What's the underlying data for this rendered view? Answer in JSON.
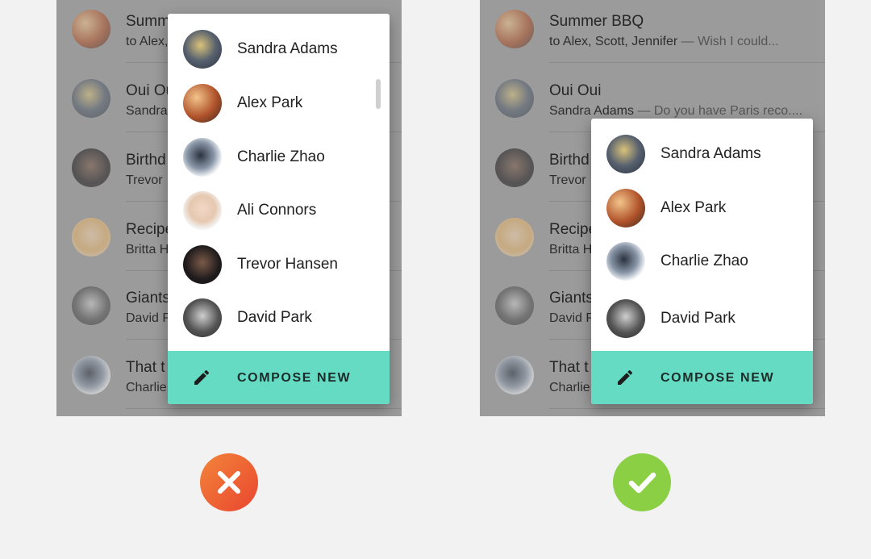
{
  "background_list": [
    {
      "title": "Summer BBQ",
      "sender": "to Alex, Scott, Jennifer",
      "snippet": "— Wish I could..."
    },
    {
      "title": "Oui Oui",
      "sender": "Sandra Adams",
      "snippet": "— Do you have Paris reco...."
    },
    {
      "title": "Birthd",
      "sender": "Trevor",
      "snippet": ""
    },
    {
      "title": "Recipe",
      "sender": "Britta H",
      "snippet": ""
    },
    {
      "title": "Giants",
      "sender": "David P",
      "snippet": ""
    },
    {
      "title": "That t",
      "sender": "Charlie",
      "snippet": ""
    }
  ],
  "incorrect_example": {
    "menu_items": [
      "Sandra Adams",
      "Alex Park",
      "Charlie Zhao",
      "Ali Connors",
      "Trevor Hansen",
      "David Park"
    ],
    "compose_label": "COMPOSE NEW",
    "verdict_icon": "close-icon",
    "verdict_color": "#ee5a35"
  },
  "correct_example": {
    "menu_items": [
      "Sandra Adams",
      "Alex Park",
      "Charlie Zhao",
      "David Park"
    ],
    "compose_label": "COMPOSE NEW",
    "verdict_icon": "check-icon",
    "verdict_color": "#8bcf45"
  },
  "colors": {
    "compose_bar": "#65dbc4",
    "page_background": "#f2f2f2"
  }
}
